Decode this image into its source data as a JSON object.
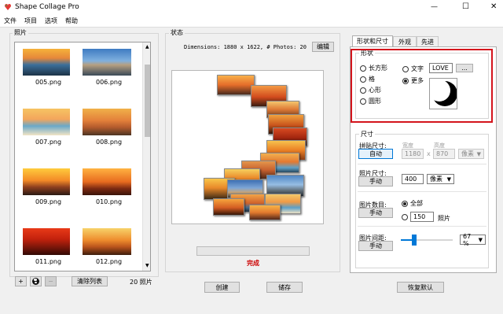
{
  "app": {
    "title": "Shape Collage Pro"
  },
  "window_controls": {
    "minimize": "—",
    "maximize": "☐",
    "close": "✕"
  },
  "menu": [
    "文件",
    "项目",
    "选项",
    "帮助"
  ],
  "photos": {
    "group_label": "照片",
    "items": [
      {
        "name": "005.png"
      },
      {
        "name": "006.png"
      },
      {
        "name": "007.png"
      },
      {
        "name": "008.png"
      },
      {
        "name": "009.png"
      },
      {
        "name": "010.png"
      },
      {
        "name": "011.png"
      },
      {
        "name": "012.png"
      }
    ],
    "add_label": "+",
    "remove_label": "−",
    "clear_label": "清除列表",
    "count_text": "20 照片"
  },
  "status": {
    "group_label": "状态",
    "dimensions_text": "Dimensions: 1880 x 1622, # Photos: 20",
    "edit_label": "编辑",
    "done_text": "完成",
    "done_color": "#cc0000"
  },
  "actions": {
    "create_label": "创建",
    "save_label": "储存"
  },
  "tabs": [
    "形状和尺寸",
    "外观",
    "先进"
  ],
  "shape": {
    "group_label": "形状",
    "options": [
      "长方形",
      "格",
      "心形",
      "圆形"
    ],
    "text_option": "文字",
    "text_value": "LOVE",
    "more_option": "更多",
    "browse_label": "...",
    "highlight_color": "#d4141c"
  },
  "size": {
    "group_label": "尺寸",
    "collage_size_label": "拼贴尺寸:",
    "auto_label": "自动",
    "width_label": "宽度",
    "height_label": "高度",
    "width_value": "1180",
    "height_value": "870",
    "x_label": "x",
    "unit_label": "像素",
    "photo_size_label": "照片尺寸:",
    "manual_label": "手动",
    "photo_size_value": "400",
    "photo_count_label": "图片数目:",
    "all_label": "全部",
    "count_value": "150",
    "photos_unit": "照片",
    "spacing_label": "图片间距:",
    "spacing_value": "67 %",
    "spacing_fraction": 0.23
  },
  "restore_label": "恢复默认"
}
